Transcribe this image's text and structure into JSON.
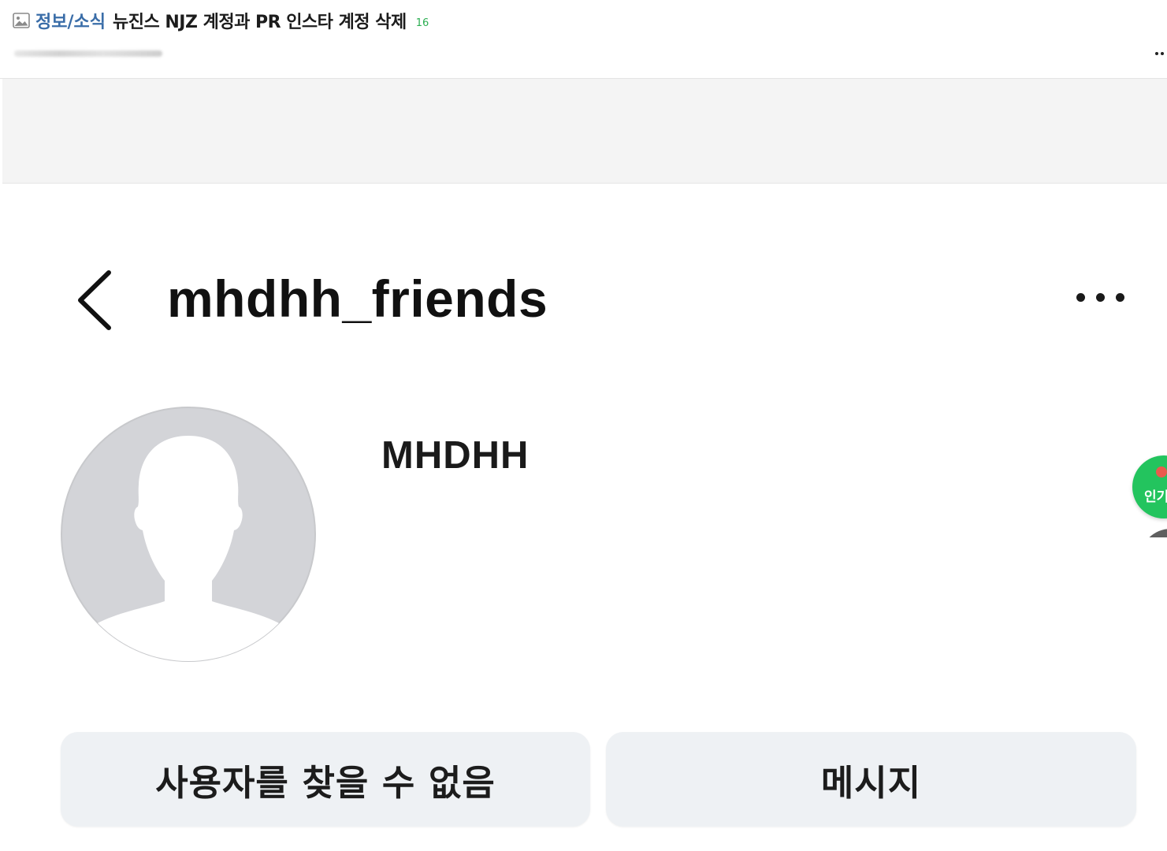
{
  "post": {
    "category": "정보/소식",
    "title": "뉴진스 NJZ 계정과 PR 인스타 계정 삭제",
    "comment_count": "16",
    "icon": "image-icon"
  },
  "profile": {
    "username": "mhdhh_friends",
    "display_name": "MHDHH",
    "avatar_icon": "default-avatar-silhouette",
    "back_icon": "chevron-left-icon",
    "more_icon": "more-horizontal-icon"
  },
  "actions": {
    "user_not_found_label": "사용자를 찾을 수 없음",
    "message_label": "메시지"
  },
  "floating": {
    "popular_label": "인기"
  },
  "colors": {
    "category": "#3a6da8",
    "comment_count": "#2cae52",
    "button_bg": "#eef1f4",
    "fab_green": "#23c45e"
  }
}
